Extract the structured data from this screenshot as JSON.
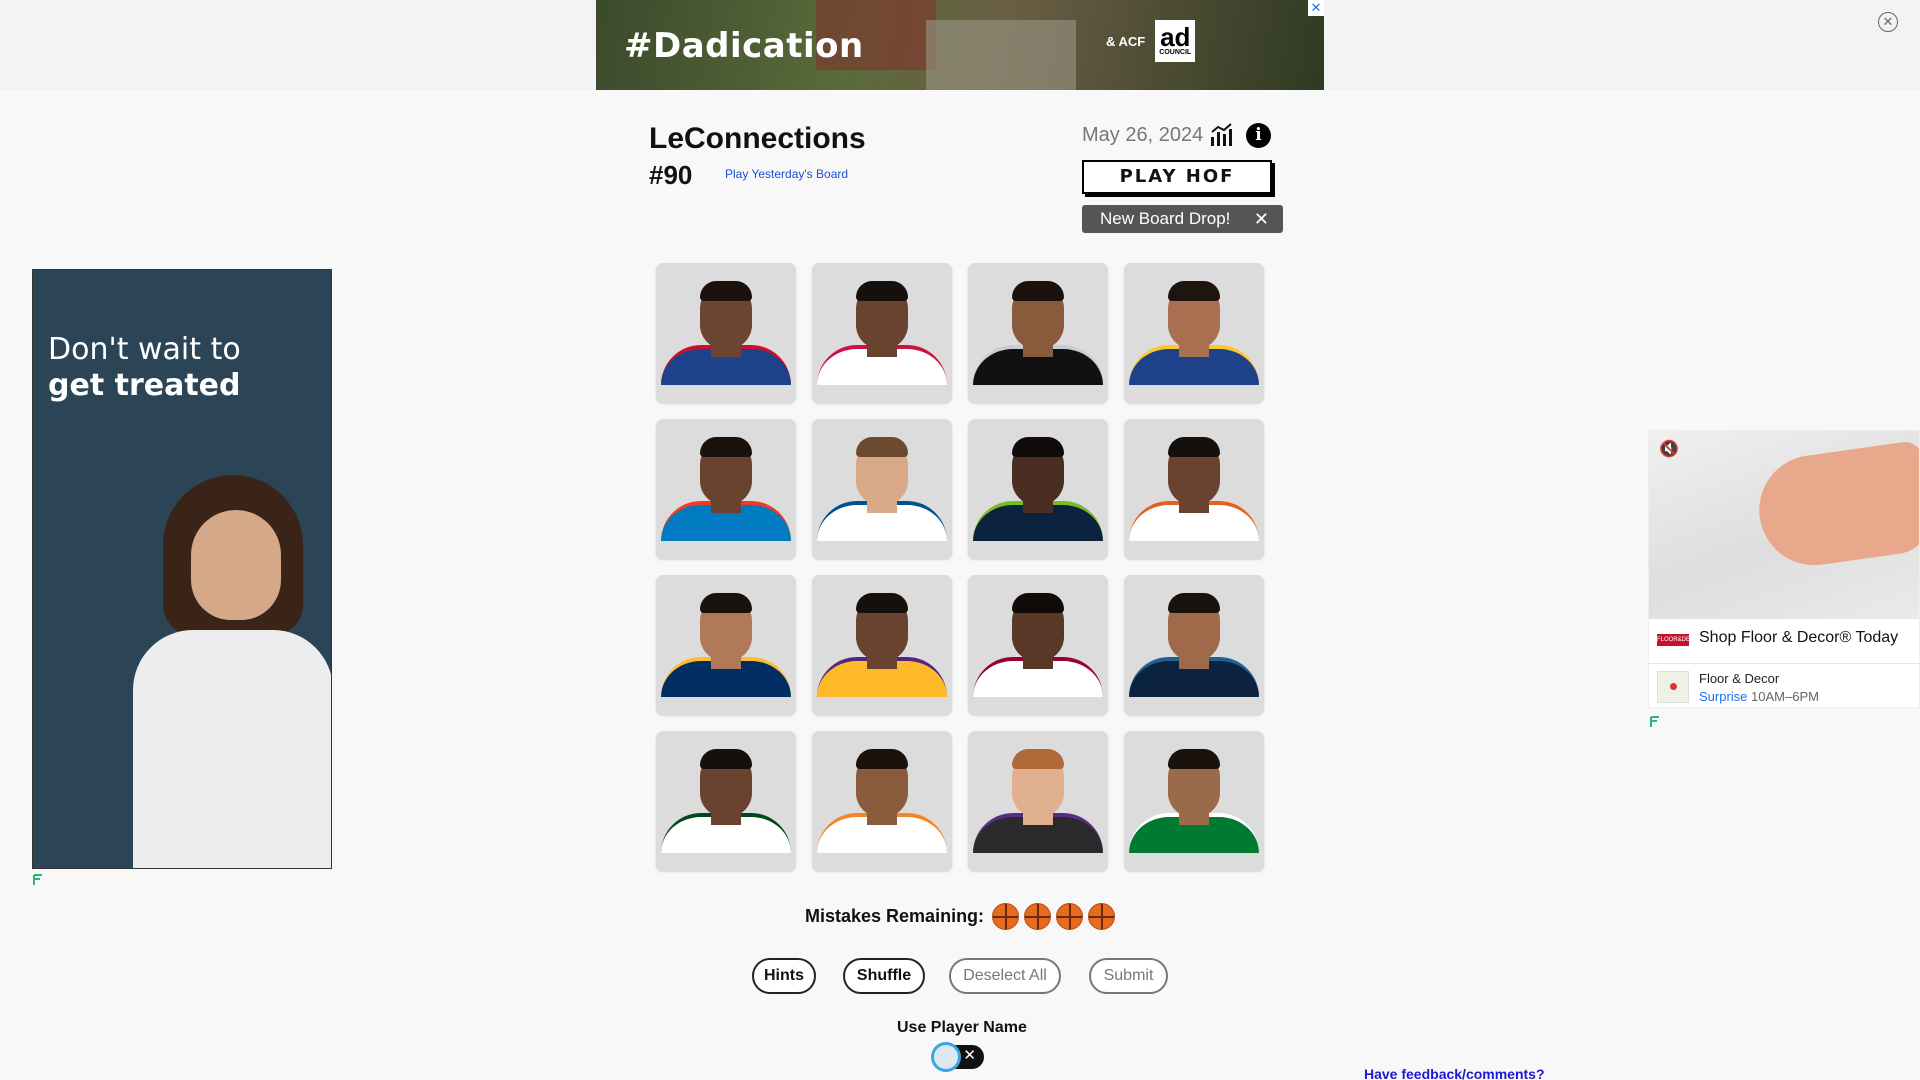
{
  "top_ad": {
    "tagline": "#Dadication",
    "logo_text": "ad",
    "logo_sub": "COUNCIL",
    "acf": "& ACF",
    "close_glyph": "✕"
  },
  "page_close_glyph": "✕",
  "header": {
    "title": "LeConnections",
    "board_number": "#90",
    "yesterday_link": "Play Yesterday's Board",
    "date": "May 26, 2024",
    "hof_button": "PLAY HOF",
    "toast_text": "New Board Drop!",
    "toast_close": "✕",
    "info_glyph": "i"
  },
  "tiles": [
    {
      "skin": "#6b4532",
      "hair": "#1b120e",
      "jersey": "#1d428a",
      "trim": "#c8102e"
    },
    {
      "skin": "#6a4230",
      "hair": "#15100c",
      "jersey": "#ffffff",
      "trim": "#ce1141"
    },
    {
      "skin": "#8a5a3c",
      "hair": "#1a120c",
      "jersey": "#111111",
      "trim": "#c4ced4"
    },
    {
      "skin": "#a87050",
      "hair": "#1e1410",
      "jersey": "#1d428a",
      "trim": "#ffc72c"
    },
    {
      "skin": "#6a4230",
      "hair": "#1a120c",
      "jersey": "#007ac1",
      "trim": "#ef3b24"
    },
    {
      "skin": "#d8a888",
      "hair": "#6b4a30",
      "jersey": "#ffffff",
      "trim": "#00538c"
    },
    {
      "skin": "#4a2e22",
      "hair": "#100a08",
      "jersey": "#0c2340",
      "trim": "#78be20"
    },
    {
      "skin": "#6a4230",
      "hair": "#15100c",
      "jersey": "#ffffff",
      "trim": "#e56020"
    },
    {
      "skin": "#b07a58",
      "hair": "#1a120c",
      "jersey": "#002d62",
      "trim": "#fdbb30"
    },
    {
      "skin": "#6a4230",
      "hair": "#15100c",
      "jersey": "#fdb927",
      "trim": "#552583"
    },
    {
      "skin": "#5a3828",
      "hair": "#100a08",
      "jersey": "#ffffff",
      "trim": "#98002e"
    },
    {
      "skin": "#a06a4a",
      "hair": "#1a120c",
      "jersey": "#0c2340",
      "trim": "#236192"
    },
    {
      "skin": "#6a4230",
      "hair": "#15100c",
      "jersey": "#ffffff",
      "trim": "#00471b"
    },
    {
      "skin": "#8a5a3c",
      "hair": "#1a120c",
      "jersey": "#ffffff",
      "trim": "#f58426"
    },
    {
      "skin": "#e0b090",
      "hair": "#b06a3a",
      "jersey": "#2a2a2a",
      "trim": "#5a2d81"
    },
    {
      "skin": "#9a6a4a",
      "hair": "#1a120c",
      "jersey": "#007a33",
      "trim": "#ffffff"
    }
  ],
  "controls": {
    "mistakes_label": "Mistakes Remaining:",
    "mistakes_remaining": 4,
    "hints": "Hints",
    "shuffle": "Shuffle",
    "deselect_all": "Deselect All",
    "submit": "Submit",
    "use_player_name": "Use Player Name",
    "toggle_x": "✕",
    "feedback": "Have feedback/comments?"
  },
  "left_ad": {
    "line1": "Don't wait to",
    "line2": "get treated"
  },
  "right_ad": {
    "title": "Shop Floor & Decor® Today",
    "brand_mark": "FLOOR&DECOR",
    "store": "Floor & Decor",
    "city": "Surprise",
    "hours": "10AM–6PM",
    "mute_glyph": "🔇"
  },
  "colors": {
    "accent_link": "#1a4fd6",
    "toggle_ring": "#39a6e0",
    "ball": "#e86a1f"
  }
}
